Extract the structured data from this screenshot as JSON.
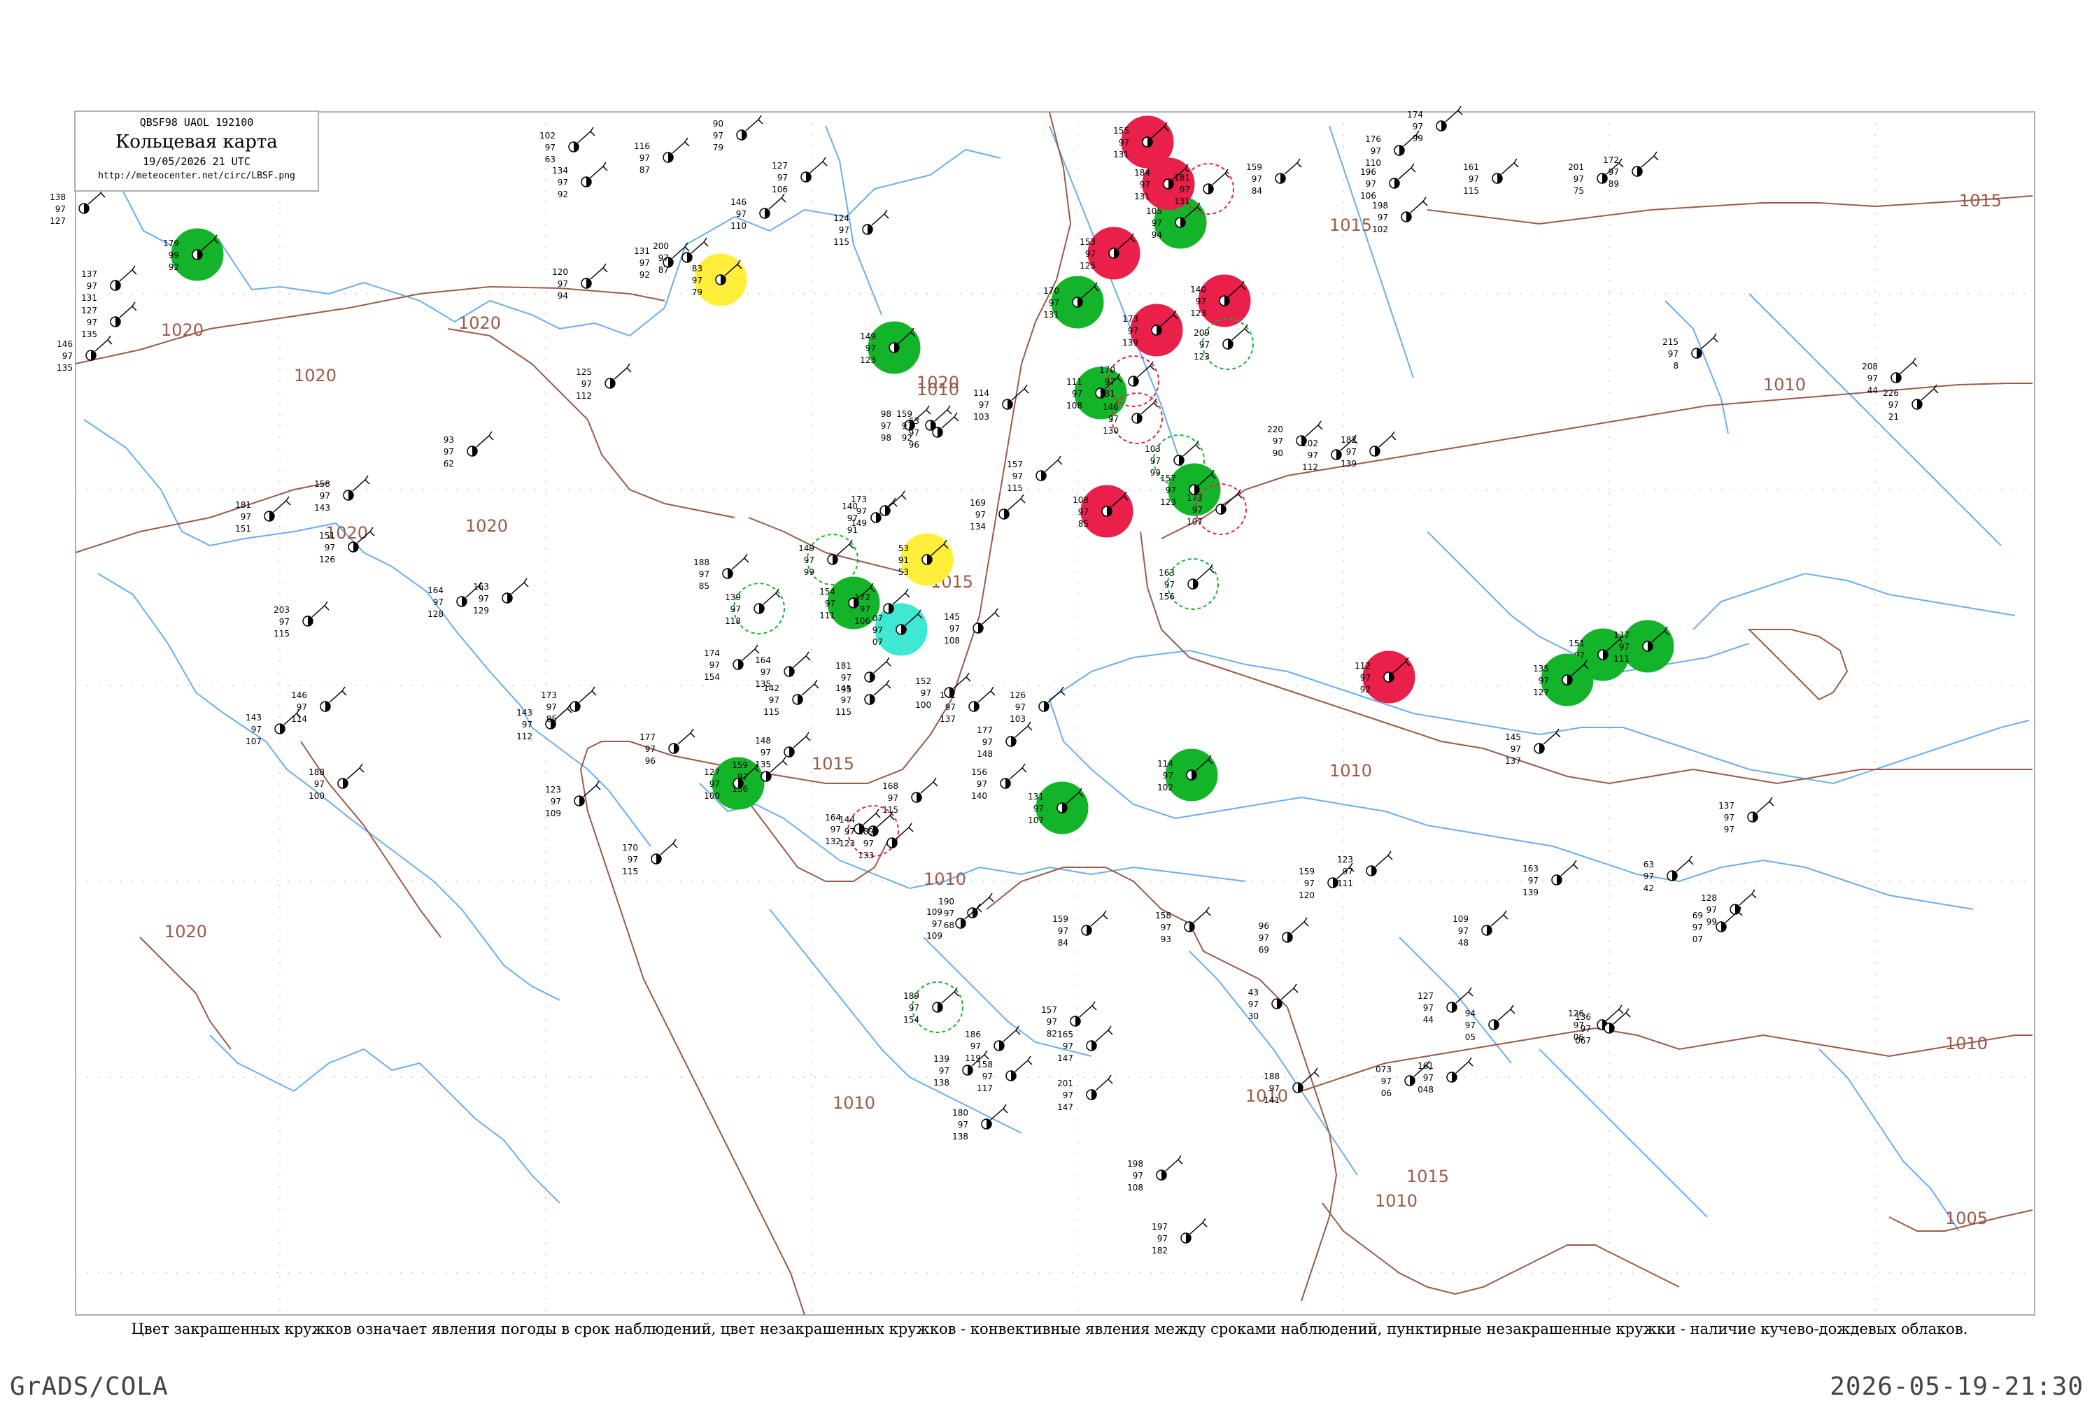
{
  "header": {
    "code_line": "QBSF98 UAOL 192100",
    "title": "Кольцевая карта",
    "datetime": "19/05/2026 21 UTC",
    "url": "http://meteocenter.net/circ/LBSF.png"
  },
  "caption": "Цвет закрашенных кружков означает явления погоды в срок наблюдений, цвет незакрашенных кружков - конвективные явления между сроками наблюдений, пунктирные незакрашенные кружки - наличие кучево-дождевых облаков.",
  "footer": {
    "left": "GrADS/COLA",
    "right": "2026-05-19-21:30"
  },
  "colors": {
    "coast": "#6aaef0",
    "isobar": "#9b5a48",
    "green": "#14b42a",
    "red": "#e8204a",
    "yellow": "#ffef3a",
    "cyan": "#3ee8d2"
  },
  "isobar_labels": [
    "1020",
    "1020",
    "1020",
    "1020",
    "1020",
    "1020",
    "1020",
    "1015",
    "1015",
    "1015",
    "1015",
    "1010",
    "1010",
    "1010",
    "1010",
    "1010",
    "1010",
    "1010",
    "1010",
    "1005",
    "1015"
  ],
  "stations": [
    {
      "color": "green",
      "fill": true,
      "nums": [
        "179",
        "99",
        "92"
      ]
    },
    {
      "color": "green",
      "fill": true,
      "nums": [
        "149",
        "97",
        "123"
      ]
    },
    {
      "color": "green",
      "fill": true,
      "nums": [
        "105",
        "97",
        "94"
      ]
    },
    {
      "color": "green",
      "fill": true,
      "nums": [
        "111",
        "97",
        "108"
      ]
    },
    {
      "color": "green",
      "fill": true,
      "nums": [
        "127",
        "97",
        "100"
      ]
    },
    {
      "color": "green",
      "fill": true,
      "nums": [
        "154",
        "97",
        "111"
      ]
    },
    {
      "color": "green",
      "fill": true,
      "nums": [
        "157",
        "97",
        "123"
      ]
    },
    {
      "color": "green",
      "fill": true,
      "nums": [
        "170",
        "97",
        "131"
      ]
    },
    {
      "color": "green",
      "fill": true,
      "nums": [
        "114",
        "97",
        "102"
      ]
    },
    {
      "color": "green",
      "fill": true,
      "nums": [
        "131",
        "97",
        "107"
      ]
    },
    {
      "color": "green",
      "fill": true,
      "nums": [
        "151",
        "97",
        "125"
      ]
    },
    {
      "color": "green",
      "fill": true,
      "nums": [
        "137",
        "97",
        "111"
      ]
    },
    {
      "color": "green",
      "fill": true,
      "nums": [
        "135",
        "97",
        "127"
      ]
    },
    {
      "color": "red",
      "fill": true,
      "nums": [
        "155",
        "97",
        "131"
      ]
    },
    {
      "color": "red",
      "fill": true,
      "nums": [
        "184",
        "97",
        "131"
      ]
    },
    {
      "color": "red",
      "fill": true,
      "nums": [
        "153",
        "97",
        "125"
      ]
    },
    {
      "color": "red",
      "fill": true,
      "nums": [
        "173",
        "97",
        "139"
      ]
    },
    {
      "color": "red",
      "fill": true,
      "nums": [
        "140",
        "97",
        "123"
      ]
    },
    {
      "color": "red",
      "fill": true,
      "nums": [
        "108",
        "97",
        "85"
      ]
    },
    {
      "color": "red",
      "fill": true,
      "nums": [
        "112",
        "97",
        "92"
      ]
    },
    {
      "color": "yellow",
      "fill": true,
      "nums": [
        "83",
        "97",
        "79"
      ]
    },
    {
      "color": "yellow",
      "fill": true,
      "nums": [
        "53",
        "91",
        "53"
      ]
    },
    {
      "color": "cyan",
      "fill": true,
      "nums": [
        "07",
        "97",
        "07"
      ]
    },
    {
      "color": "green",
      "fill": false,
      "nums": [
        "209",
        "97",
        "123"
      ]
    },
    {
      "color": "green",
      "fill": false,
      "nums": [
        "139",
        "97",
        "118"
      ]
    },
    {
      "color": "green",
      "fill": false,
      "nums": [
        "149",
        "97",
        "99"
      ]
    },
    {
      "color": "green",
      "fill": false,
      "nums": [
        "163",
        "97",
        "156"
      ]
    },
    {
      "color": "green",
      "fill": false,
      "nums": [
        "189",
        "97",
        "154"
      ]
    },
    {
      "color": "green",
      "fill": false,
      "nums": [
        "103",
        "97",
        "99"
      ]
    },
    {
      "color": "red",
      "fill": false,
      "nums": [
        "170",
        "97",
        "131"
      ]
    },
    {
      "color": "red",
      "fill": false,
      "nums": [
        "146",
        "97",
        "130"
      ]
    },
    {
      "color": "red",
      "fill": false,
      "nums": [
        "144",
        "97",
        "123"
      ]
    },
    {
      "color": "red",
      "fill": false,
      "nums": [
        "173",
        "97",
        "107"
      ]
    },
    {
      "color": "red",
      "fill": false,
      "nums": [
        "181",
        "97",
        "131"
      ]
    },
    {
      "color": "none",
      "fill": false,
      "nums": [
        "138",
        "97",
        "127"
      ]
    },
    {
      "color": "none",
      "fill": false,
      "nums": [
        "137",
        "97",
        "131"
      ]
    },
    {
      "color": "none",
      "fill": false,
      "nums": [
        "127",
        "97",
        "135"
      ]
    },
    {
      "color": "none",
      "fill": false,
      "nums": [
        "146",
        "97",
        "135"
      ]
    },
    {
      "color": "none",
      "fill": false,
      "nums": [
        "102",
        "97",
        "63"
      ]
    },
    {
      "color": "none",
      "fill": false,
      "nums": [
        "116",
        "97",
        "87"
      ]
    },
    {
      "color": "none",
      "fill": false,
      "nums": [
        "90",
        "97",
        "79"
      ]
    },
    {
      "color": "none",
      "fill": false,
      "nums": [
        "134",
        "97",
        "92"
      ]
    },
    {
      "color": "none",
      "fill": false,
      "nums": [
        "131",
        "97",
        "92"
      ]
    },
    {
      "color": "none",
      "fill": false,
      "nums": [
        "200",
        "97",
        "87"
      ]
    },
    {
      "color": "none",
      "fill": false,
      "nums": [
        "120",
        "97",
        "94"
      ]
    },
    {
      "color": "none",
      "fill": false,
      "nums": [
        "125",
        "97",
        "112"
      ]
    },
    {
      "color": "none",
      "fill": false,
      "nums": [
        "146",
        "97",
        "110"
      ]
    },
    {
      "color": "none",
      "fill": false,
      "nums": [
        "124",
        "97",
        "115"
      ]
    },
    {
      "color": "none",
      "fill": false,
      "nums": [
        "127",
        "97",
        "106"
      ]
    },
    {
      "color": "none",
      "fill": false,
      "nums": [
        "176",
        "97",
        "110"
      ]
    },
    {
      "color": "none",
      "fill": false,
      "nums": [
        "196",
        "97",
        "106"
      ]
    },
    {
      "color": "none",
      "fill": false,
      "nums": [
        "198",
        "97",
        "102"
      ]
    },
    {
      "color": "none",
      "fill": false,
      "nums": [
        "161",
        "97",
        "115"
      ]
    },
    {
      "color": "none",
      "fill": false,
      "nums": [
        "201",
        "97",
        "75"
      ]
    },
    {
      "color": "none",
      "fill": false,
      "nums": [
        "172",
        "97",
        "89"
      ]
    },
    {
      "color": "none",
      "fill": false,
      "nums": [
        "174",
        "97",
        "99"
      ]
    },
    {
      "color": "none",
      "fill": false,
      "nums": [
        "159",
        "97",
        "84"
      ]
    },
    {
      "color": "none",
      "fill": false,
      "nums": [
        "220",
        "97",
        "90"
      ]
    },
    {
      "color": "none",
      "fill": false,
      "nums": [
        "202",
        "97",
        "112"
      ]
    },
    {
      "color": "none",
      "fill": false,
      "nums": [
        "182",
        "97",
        "139"
      ]
    },
    {
      "color": "none",
      "fill": false,
      "nums": [
        "215",
        "97",
        "8"
      ]
    },
    {
      "color": "none",
      "fill": false,
      "nums": [
        "208",
        "97",
        "44"
      ]
    },
    {
      "color": "none",
      "fill": false,
      "nums": [
        "226",
        "97",
        "21"
      ]
    },
    {
      "color": "none",
      "fill": false,
      "nums": [
        "145",
        "97",
        "137"
      ]
    },
    {
      "color": "none",
      "fill": false,
      "nums": [
        "137",
        "97",
        "97"
      ]
    },
    {
      "color": "none",
      "fill": false,
      "nums": [
        "163",
        "97",
        "139"
      ]
    },
    {
      "color": "none",
      "fill": false,
      "nums": [
        "109",
        "97",
        "48"
      ]
    },
    {
      "color": "none",
      "fill": false,
      "nums": [
        "69",
        "97",
        "07"
      ]
    },
    {
      "color": "none",
      "fill": false,
      "nums": [
        "63",
        "97",
        "42"
      ]
    },
    {
      "color": "none",
      "fill": false,
      "nums": [
        "128",
        "97",
        "99"
      ]
    },
    {
      "color": "none",
      "fill": false,
      "nums": [
        "159",
        "97",
        "120"
      ]
    },
    {
      "color": "none",
      "fill": false,
      "nums": [
        "123",
        "97",
        "111"
      ]
    },
    {
      "color": "none",
      "fill": false,
      "nums": [
        "127",
        "97",
        "44"
      ]
    },
    {
      "color": "none",
      "fill": false,
      "nums": [
        "94",
        "97",
        "05"
      ]
    },
    {
      "color": "none",
      "fill": false,
      "nums": [
        "126",
        "97",
        "06"
      ]
    },
    {
      "color": "none",
      "fill": false,
      "nums": [
        "136",
        "97",
        "067"
      ]
    },
    {
      "color": "none",
      "fill": false,
      "nums": [
        "161",
        "97",
        "048"
      ]
    },
    {
      "color": "none",
      "fill": false,
      "nums": [
        "073",
        "97",
        "06"
      ]
    },
    {
      "color": "none",
      "fill": false,
      "nums": [
        "188",
        "97",
        "141"
      ]
    },
    {
      "color": "none",
      "fill": false,
      "nums": [
        "96",
        "97",
        "69"
      ]
    },
    {
      "color": "none",
      "fill": false,
      "nums": [
        "43",
        "97",
        "30"
      ]
    },
    {
      "color": "none",
      "fill": false,
      "nums": [
        "158",
        "97",
        "93"
      ]
    },
    {
      "color": "none",
      "fill": false,
      "nums": [
        "159",
        "97",
        "84"
      ]
    },
    {
      "color": "none",
      "fill": false,
      "nums": [
        "157",
        "97",
        "82"
      ]
    },
    {
      "color": "none",
      "fill": false,
      "nums": [
        "165",
        "97",
        "147"
      ]
    },
    {
      "color": "none",
      "fill": false,
      "nums": [
        "201",
        "97",
        "147"
      ]
    },
    {
      "color": "none",
      "fill": false,
      "nums": [
        "198",
        "97",
        "108"
      ]
    },
    {
      "color": "none",
      "fill": false,
      "nums": [
        "197",
        "97",
        "182"
      ]
    },
    {
      "color": "none",
      "fill": false,
      "nums": [
        "190",
        "97",
        "68"
      ]
    },
    {
      "color": "none",
      "fill": false,
      "nums": [
        "109",
        "97",
        "109"
      ]
    },
    {
      "color": "none",
      "fill": false,
      "nums": [
        "139",
        "97",
        "138"
      ]
    },
    {
      "color": "none",
      "fill": false,
      "nums": [
        "180",
        "97",
        "138"
      ]
    },
    {
      "color": "none",
      "fill": false,
      "nums": [
        "186",
        "97",
        "119"
      ]
    },
    {
      "color": "none",
      "fill": false,
      "nums": [
        "158",
        "97",
        "117"
      ]
    },
    {
      "color": "none",
      "fill": false,
      "nums": [
        "164",
        "97",
        "132"
      ]
    },
    {
      "color": "none",
      "fill": false,
      "nums": [
        "189",
        "97",
        "133"
      ]
    },
    {
      "color": "none",
      "fill": false,
      "nums": [
        "148",
        "97",
        "135"
      ]
    },
    {
      "color": "none",
      "fill": false,
      "nums": [
        "159",
        "97",
        "136"
      ]
    },
    {
      "color": "none",
      "fill": false,
      "nums": [
        "177",
        "97",
        "148"
      ]
    },
    {
      "color": "none",
      "fill": false,
      "nums": [
        "126",
        "97",
        "103"
      ]
    },
    {
      "color": "none",
      "fill": false,
      "nums": [
        "156",
        "97",
        "140"
      ]
    },
    {
      "color": "none",
      "fill": false,
      "nums": [
        "141",
        "97",
        "137"
      ]
    },
    {
      "color": "none",
      "fill": false,
      "nums": [
        "145",
        "97",
        "108"
      ]
    },
    {
      "color": "none",
      "fill": false,
      "nums": [
        "152",
        "97",
        "100"
      ]
    },
    {
      "color": "none",
      "fill": false,
      "nums": [
        "168",
        "97",
        "115"
      ]
    },
    {
      "color": "none",
      "fill": false,
      "nums": [
        "181",
        "97",
        "95"
      ]
    },
    {
      "color": "none",
      "fill": false,
      "nums": [
        "164",
        "97",
        "135"
      ]
    },
    {
      "color": "none",
      "fill": false,
      "nums": [
        "142",
        "97",
        "115"
      ]
    },
    {
      "color": "none",
      "fill": false,
      "nums": [
        "145",
        "97",
        "115"
      ]
    },
    {
      "color": "none",
      "fill": false,
      "nums": [
        "98",
        "97",
        "98"
      ]
    },
    {
      "color": "none",
      "fill": false,
      "nums": [
        "159",
        "97",
        "92"
      ]
    },
    {
      "color": "none",
      "fill": false,
      "nums": [
        "140",
        "97",
        "91"
      ]
    },
    {
      "color": "none",
      "fill": false,
      "nums": [
        "173",
        "97",
        "149"
      ]
    },
    {
      "color": "none",
      "fill": false,
      "nums": [
        "172",
        "97",
        "106"
      ]
    },
    {
      "color": "none",
      "fill": false,
      "nums": [
        "157",
        "97",
        "115"
      ]
    },
    {
      "color": "none",
      "fill": false,
      "nums": [
        "169",
        "97",
        "134"
      ]
    },
    {
      "color": "none",
      "fill": false,
      "nums": [
        "114",
        "97",
        "103"
      ]
    },
    {
      "color": "none",
      "fill": false,
      "nums": [
        "63",
        "97",
        "96"
      ]
    },
    {
      "color": "none",
      "fill": false,
      "nums": [
        "174",
        "97",
        "154"
      ]
    },
    {
      "color": "none",
      "fill": false,
      "nums": [
        "170",
        "97",
        "115"
      ]
    },
    {
      "color": "none",
      "fill": false,
      "nums": [
        "177",
        "97",
        "96"
      ]
    },
    {
      "color": "none",
      "fill": false,
      "nums": [
        "143",
        "97",
        "112"
      ]
    },
    {
      "color": "none",
      "fill": false,
      "nums": [
        "123",
        "97",
        "109"
      ]
    },
    {
      "color": "none",
      "fill": false,
      "nums": [
        "173",
        "97",
        "85"
      ]
    },
    {
      "color": "none",
      "fill": false,
      "nums": [
        "188",
        "97",
        "85"
      ]
    },
    {
      "color": "none",
      "fill": false,
      "nums": [
        "163",
        "97",
        "129"
      ]
    },
    {
      "color": "none",
      "fill": false,
      "nums": [
        "158",
        "97",
        "143"
      ]
    },
    {
      "color": "none",
      "fill": false,
      "nums": [
        "151",
        "97",
        "126"
      ]
    },
    {
      "color": "none",
      "fill": false,
      "nums": [
        "181",
        "97",
        "151"
      ]
    },
    {
      "color": "none",
      "fill": false,
      "nums": [
        "203",
        "97",
        "115"
      ]
    },
    {
      "color": "none",
      "fill": false,
      "nums": [
        "146",
        "97",
        "114"
      ]
    },
    {
      "color": "none",
      "fill": false,
      "nums": [
        "143",
        "97",
        "107"
      ]
    },
    {
      "color": "none",
      "fill": false,
      "nums": [
        "188",
        "97",
        "100"
      ]
    },
    {
      "color": "none",
      "fill": false,
      "nums": [
        "93",
        "97",
        "62"
      ]
    },
    {
      "color": "none",
      "fill": false,
      "nums": [
        "164",
        "97",
        "128"
      ]
    }
  ]
}
